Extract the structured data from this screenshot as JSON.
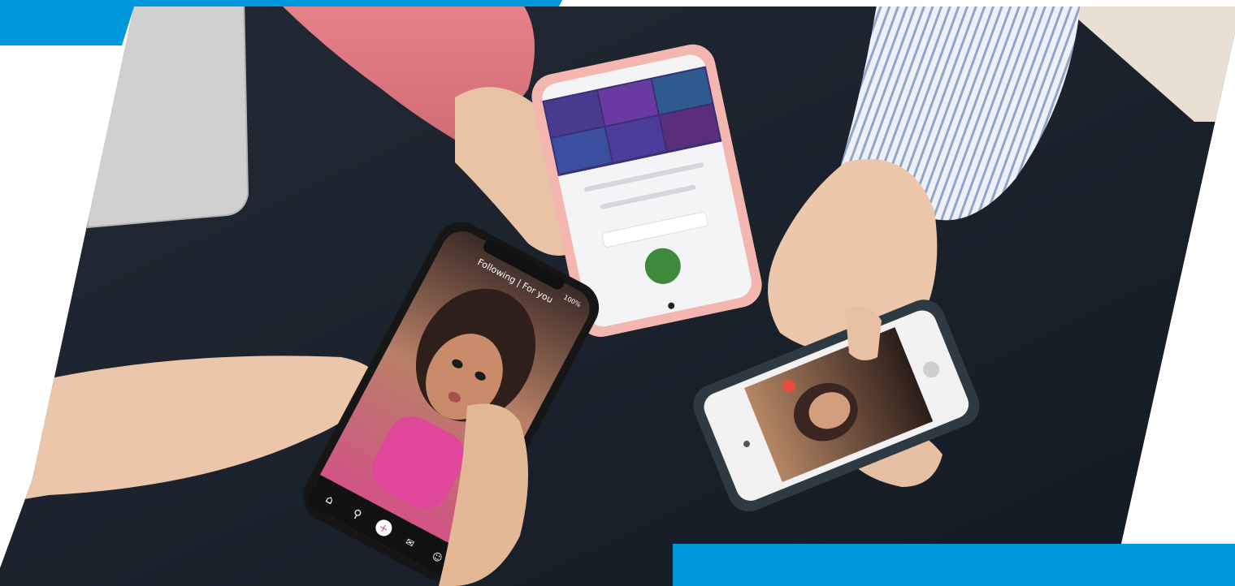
{
  "photo": {
    "subject": "hands-holding-smartphones",
    "accent_color": "#0096dc",
    "table_color": "#1d2430"
  },
  "phone_left": {
    "top_nav": "Following | For you",
    "battery_text": "100%",
    "nav_icons": [
      "home-icon",
      "search-icon",
      "plus-icon",
      "inbox-icon",
      "profile-icon"
    ]
  },
  "phone_top": {
    "screen": "profile-page"
  },
  "phone_right": {
    "screen": "video-feed"
  }
}
